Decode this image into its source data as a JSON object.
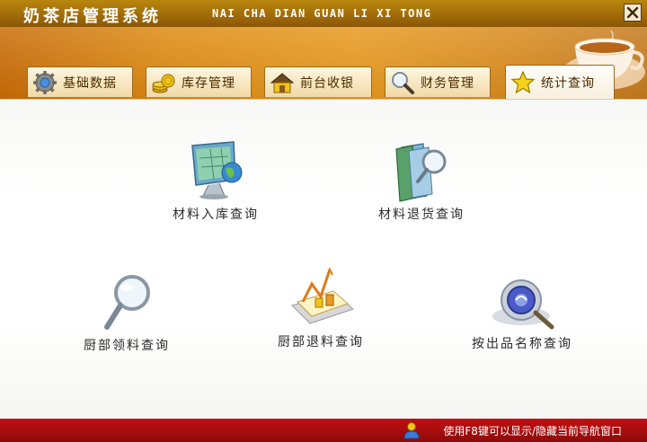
{
  "window": {
    "title": "奶茶店管理系统",
    "subtitle": "NAI CHA DIAN GUAN LI XI TONG",
    "close_glyph": "×"
  },
  "tabs": [
    {
      "label": "基础数据",
      "icon": "gear-icon",
      "active": false
    },
    {
      "label": "库存管理",
      "icon": "coins-icon",
      "active": false
    },
    {
      "label": "前台收银",
      "icon": "house-icon",
      "active": false
    },
    {
      "label": "财务管理",
      "icon": "magnifier-icon",
      "active": false
    },
    {
      "label": "统计查询",
      "icon": "star-icon",
      "active": true
    }
  ],
  "items": [
    {
      "label": "材料入库查询",
      "icon": "monitor-globe-icon"
    },
    {
      "label": "材料退货查询",
      "icon": "folder-magnifier-icon"
    },
    {
      "label": "厨部领料查询",
      "icon": "magnifier-icon"
    },
    {
      "label": "厨部退料查询",
      "icon": "chart-icon"
    },
    {
      "label": "按出品名称查询",
      "icon": "disc-search-icon"
    }
  ],
  "status": {
    "text": "使用F8键可以显示/隐藏当前导航窗口",
    "icon": "user-icon"
  },
  "colors": {
    "title_bar": "#a06a08",
    "banner": "#e79a20",
    "status_bar": "#b01010"
  }
}
